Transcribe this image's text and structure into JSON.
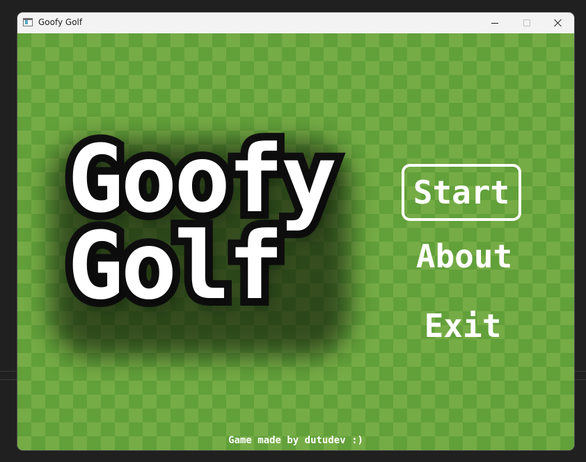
{
  "window": {
    "title": "Goofy Golf"
  },
  "game": {
    "logo_line1": "Goofy",
    "logo_line2": "Golf",
    "menu": {
      "start": "Start",
      "about": "About",
      "exit": "Exit"
    },
    "selected_item": "Start",
    "credit": "Game made by dutudev :)"
  },
  "colors": {
    "checker_dark": "#62a03a",
    "checker_light": "#75ac45",
    "text": "#ffffff",
    "logo_outline": "#0f0f0f"
  },
  "icons": {
    "app": "app-window-icon",
    "minimize": "minimize-icon",
    "maximize": "maximize-icon",
    "close": "close-icon"
  }
}
